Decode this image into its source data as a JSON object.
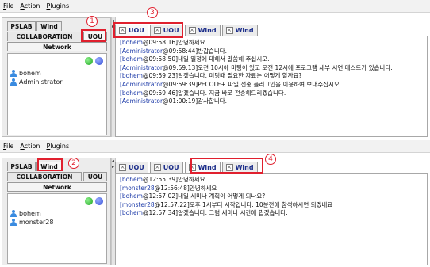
{
  "menu": [
    "File",
    "Action",
    "Plugins"
  ],
  "top": {
    "left_tabs": [
      "PSLAB",
      "Wind",
      "COLLABORATION",
      "UOU"
    ],
    "network_label": "Network",
    "users": [
      "bohem",
      "Administrator"
    ],
    "chat_tabs": [
      "UOU",
      "UOU",
      "Wind",
      "Wind"
    ],
    "messages": [
      {
        "sender": "[bohem",
        "time": "@09:58:16]",
        "text": "안녕하세요"
      },
      {
        "sender": "[Administrator",
        "time": "@09:58:44]",
        "text": "반갑습니다."
      },
      {
        "sender": "[bohem",
        "time": "@09:58:50]",
        "text": "내일 일정에 대해서 말씀해 주십시오."
      },
      {
        "sender": "[Administrator",
        "time": "@09:59:13]",
        "text": "오전 10시에 미팅이 있고 오전 12시에 프로그램 세부 시연 테스트가 있습니다."
      },
      {
        "sender": "[bohem",
        "time": "@09:59:23]",
        "text": "알겠습니다. 미팅때 필요한 자료는 어떻게 할까요?"
      },
      {
        "sender": "[Administrator",
        "time": "@09:59:39]",
        "text": "PECOLE+ 파일 전송 플러그인을 이용하여 보내주십시오."
      },
      {
        "sender": "[bohem",
        "time": "@09:59:46]",
        "text": "알겠습니다. 지금 바로 전송해드리겠습니다."
      },
      {
        "sender": "[Administrator",
        "time": "@01:00:19]",
        "text": "감사합니다."
      }
    ],
    "callout_left": "1",
    "callout_right": "3"
  },
  "bottom": {
    "left_tabs": [
      "PSLAB",
      "Wind",
      "COLLABORATION",
      "UOU"
    ],
    "network_label": "Network",
    "users": [
      "bohem",
      "monster28"
    ],
    "chat_tabs": [
      "UOU",
      "UOU",
      "Wind",
      "Wind"
    ],
    "messages": [
      {
        "sender": "[bohem",
        "time": "@12:55:39]",
        "text": "안녕하세요"
      },
      {
        "sender": "[monster28",
        "time": "@12:56:48]",
        "text": "안녕하세요"
      },
      {
        "sender": "[bohem",
        "time": "@12:57:02]",
        "text": "내일 세미나 계획이 어떻게 되나요?"
      },
      {
        "sender": "[monster28",
        "time": "@12:57:22]",
        "text": "오후 1시부터 시작입니다. 10분전에 참석하시면 되겠네요"
      },
      {
        "sender": "[bohem",
        "time": "@12:57:34]",
        "text": "알겠습니다. 그럼 세미나 시간에 뵙겠습니다."
      }
    ],
    "callout_left": "2",
    "callout_right": "4"
  },
  "colors": {
    "accent_red": "#e0202e",
    "tab_text": "#1c2e8a",
    "sender_blue": "#1c3aa8"
  },
  "icons": [
    "user-icon",
    "close-icon",
    "green-status-icon",
    "blue-status-icon"
  ]
}
